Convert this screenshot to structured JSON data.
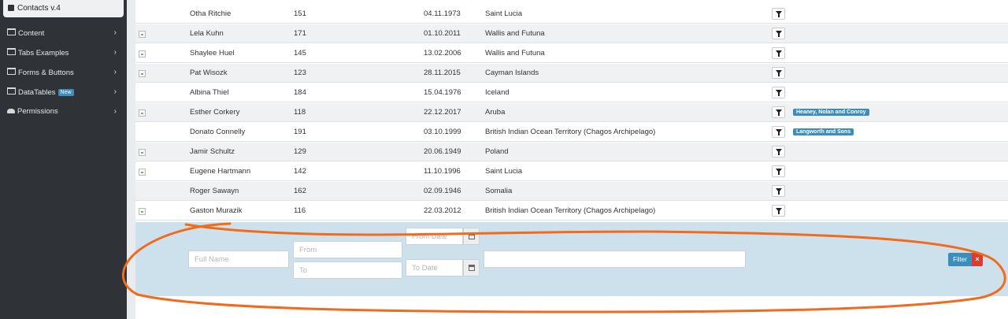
{
  "sidebar": {
    "brand": "Contacts v.4",
    "items": [
      {
        "label": "Content",
        "icon": "window-icon"
      },
      {
        "label": "Tabs Examples",
        "icon": "window-icon"
      },
      {
        "label": "Forms & Buttons",
        "icon": "window-icon"
      },
      {
        "label": "DataTables",
        "icon": "window-icon",
        "badge": "New"
      },
      {
        "label": "Permissions",
        "icon": "users-icon"
      }
    ]
  },
  "table": {
    "rows": [
      {
        "image": false,
        "name": "Otha Ritchie",
        "number": "151",
        "date": "04.11.1973",
        "country": "Saint Lucia",
        "company": ""
      },
      {
        "image": true,
        "name": "Lela Kuhn",
        "number": "171",
        "date": "01.10.2011",
        "country": "Wallis and Futuna",
        "company": ""
      },
      {
        "image": true,
        "name": "Shaylee Huel",
        "number": "145",
        "date": "13.02.2006",
        "country": "Wallis and Futuna",
        "company": ""
      },
      {
        "image": true,
        "name": "Pat Wisozk",
        "number": "123",
        "date": "28.11.2015",
        "country": "Cayman Islands",
        "company": ""
      },
      {
        "image": false,
        "name": "Albina Thiel",
        "number": "184",
        "date": "15.04.1976",
        "country": "Iceland",
        "company": ""
      },
      {
        "image": true,
        "name": "Esther Corkery",
        "number": "118",
        "date": "22.12.2017",
        "country": "Aruba",
        "company": "Heaney, Nolan and Conroy"
      },
      {
        "image": false,
        "name": "Donato Connelly",
        "number": "191",
        "date": "03.10.1999",
        "country": "British Indian Ocean Territory (Chagos Archipelago)",
        "company": "Langworth and Sons"
      },
      {
        "image": true,
        "name": "Jamir Schultz",
        "number": "129",
        "date": "20.06.1949",
        "country": "Poland",
        "company": ""
      },
      {
        "image": true,
        "name": "Eugene Hartmann",
        "number": "142",
        "date": "11.10.1996",
        "country": "Saint Lucia",
        "company": ""
      },
      {
        "image": false,
        "name": "Roger Sawayn",
        "number": "162",
        "date": "02.09.1946",
        "country": "Somalia",
        "company": ""
      },
      {
        "image": true,
        "name": "Gaston Murazik",
        "number": "116",
        "date": "22.03.2012",
        "country": "British Indian Ocean Territory (Chagos Archipelago)",
        "company": ""
      }
    ]
  },
  "filters": {
    "full_name_placeholder": "Full Name",
    "number_from_placeholder": "From",
    "number_to_placeholder": "To",
    "date_from_placeholder": "From Date",
    "date_to_placeholder": "To Date",
    "country_value": "",
    "filter_label": "Filter",
    "close_label": "×"
  },
  "colors": {
    "sidebar_bg": "#2f3338",
    "accent": "#3c8dbc",
    "filter_area_bg": "#cde1ec",
    "annotation": "#f26a1b",
    "danger": "#dd3b2f"
  }
}
